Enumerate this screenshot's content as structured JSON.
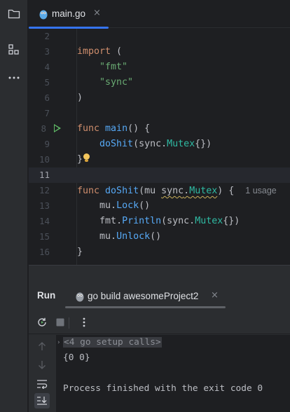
{
  "tab": {
    "filename": "main.go",
    "close": "×"
  },
  "code": {
    "lines": [
      {
        "n": "2"
      },
      {
        "n": "3",
        "kw": "import",
        "rest": " ("
      },
      {
        "n": "4",
        "str": "\"fmt\""
      },
      {
        "n": "5",
        "str": "\"sync\""
      },
      {
        "n": "6",
        "text": ")"
      },
      {
        "n": "7"
      },
      {
        "n": "8",
        "kw": "func",
        "fn": "main",
        "rest": "() {"
      },
      {
        "n": "9",
        "call": "doShit",
        "pkg": "sync",
        "typ": "Mutex",
        "rest": "{})"
      },
      {
        "n": "10",
        "text": "}"
      },
      {
        "n": "11"
      },
      {
        "n": "12",
        "kw": "func",
        "fn": "doShit",
        "param": "mu",
        "pkg": "sync",
        "typ": "Mutex",
        "rest": ") {",
        "hint": "1 usage"
      },
      {
        "n": "13",
        "recv": "mu",
        "call": "Lock",
        "rest": "()"
      },
      {
        "n": "14",
        "recv": "fmt",
        "call": "Println",
        "pkg": "sync",
        "typ": "Mutex",
        "rest": "{})"
      },
      {
        "n": "15",
        "recv": "mu",
        "call": "Unlock",
        "rest": "()"
      },
      {
        "n": "16",
        "text": "}"
      }
    ]
  },
  "run": {
    "title": "Run",
    "config_tab": "go build awesomeProject2",
    "close": "×",
    "console": {
      "folded": "<4 go setup calls>",
      "output": "{0 0}",
      "exit": "Process finished with the exit code 0"
    }
  },
  "colors": {
    "accent": "#3574f0",
    "run_green": "#5fb865",
    "keyword": "#cf8e6d",
    "function": "#56a8f5",
    "type": "#2fbaa3",
    "string": "#6aab73"
  }
}
